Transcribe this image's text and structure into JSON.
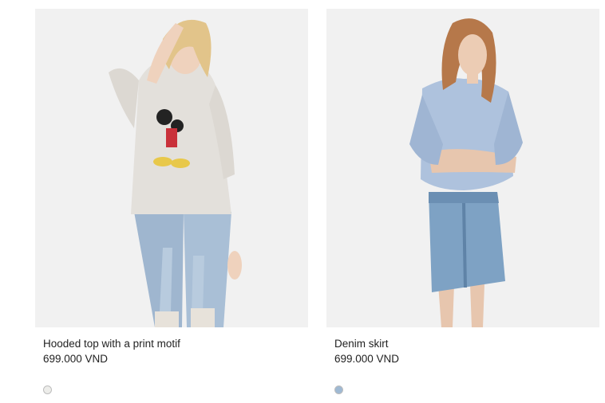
{
  "products": [
    {
      "title": "Hooded top with a print motif",
      "price": "699.000 VND",
      "swatch_color": "#ededea",
      "image_label": "model-wearing-hooded-top"
    },
    {
      "title": "Denim skirt",
      "price": "699.000 VND",
      "swatch_color": "#9fb9d3",
      "image_label": "model-wearing-denim-skirt"
    }
  ],
  "colors": {
    "image_background": "#f1f1f1",
    "text": "#222222"
  }
}
